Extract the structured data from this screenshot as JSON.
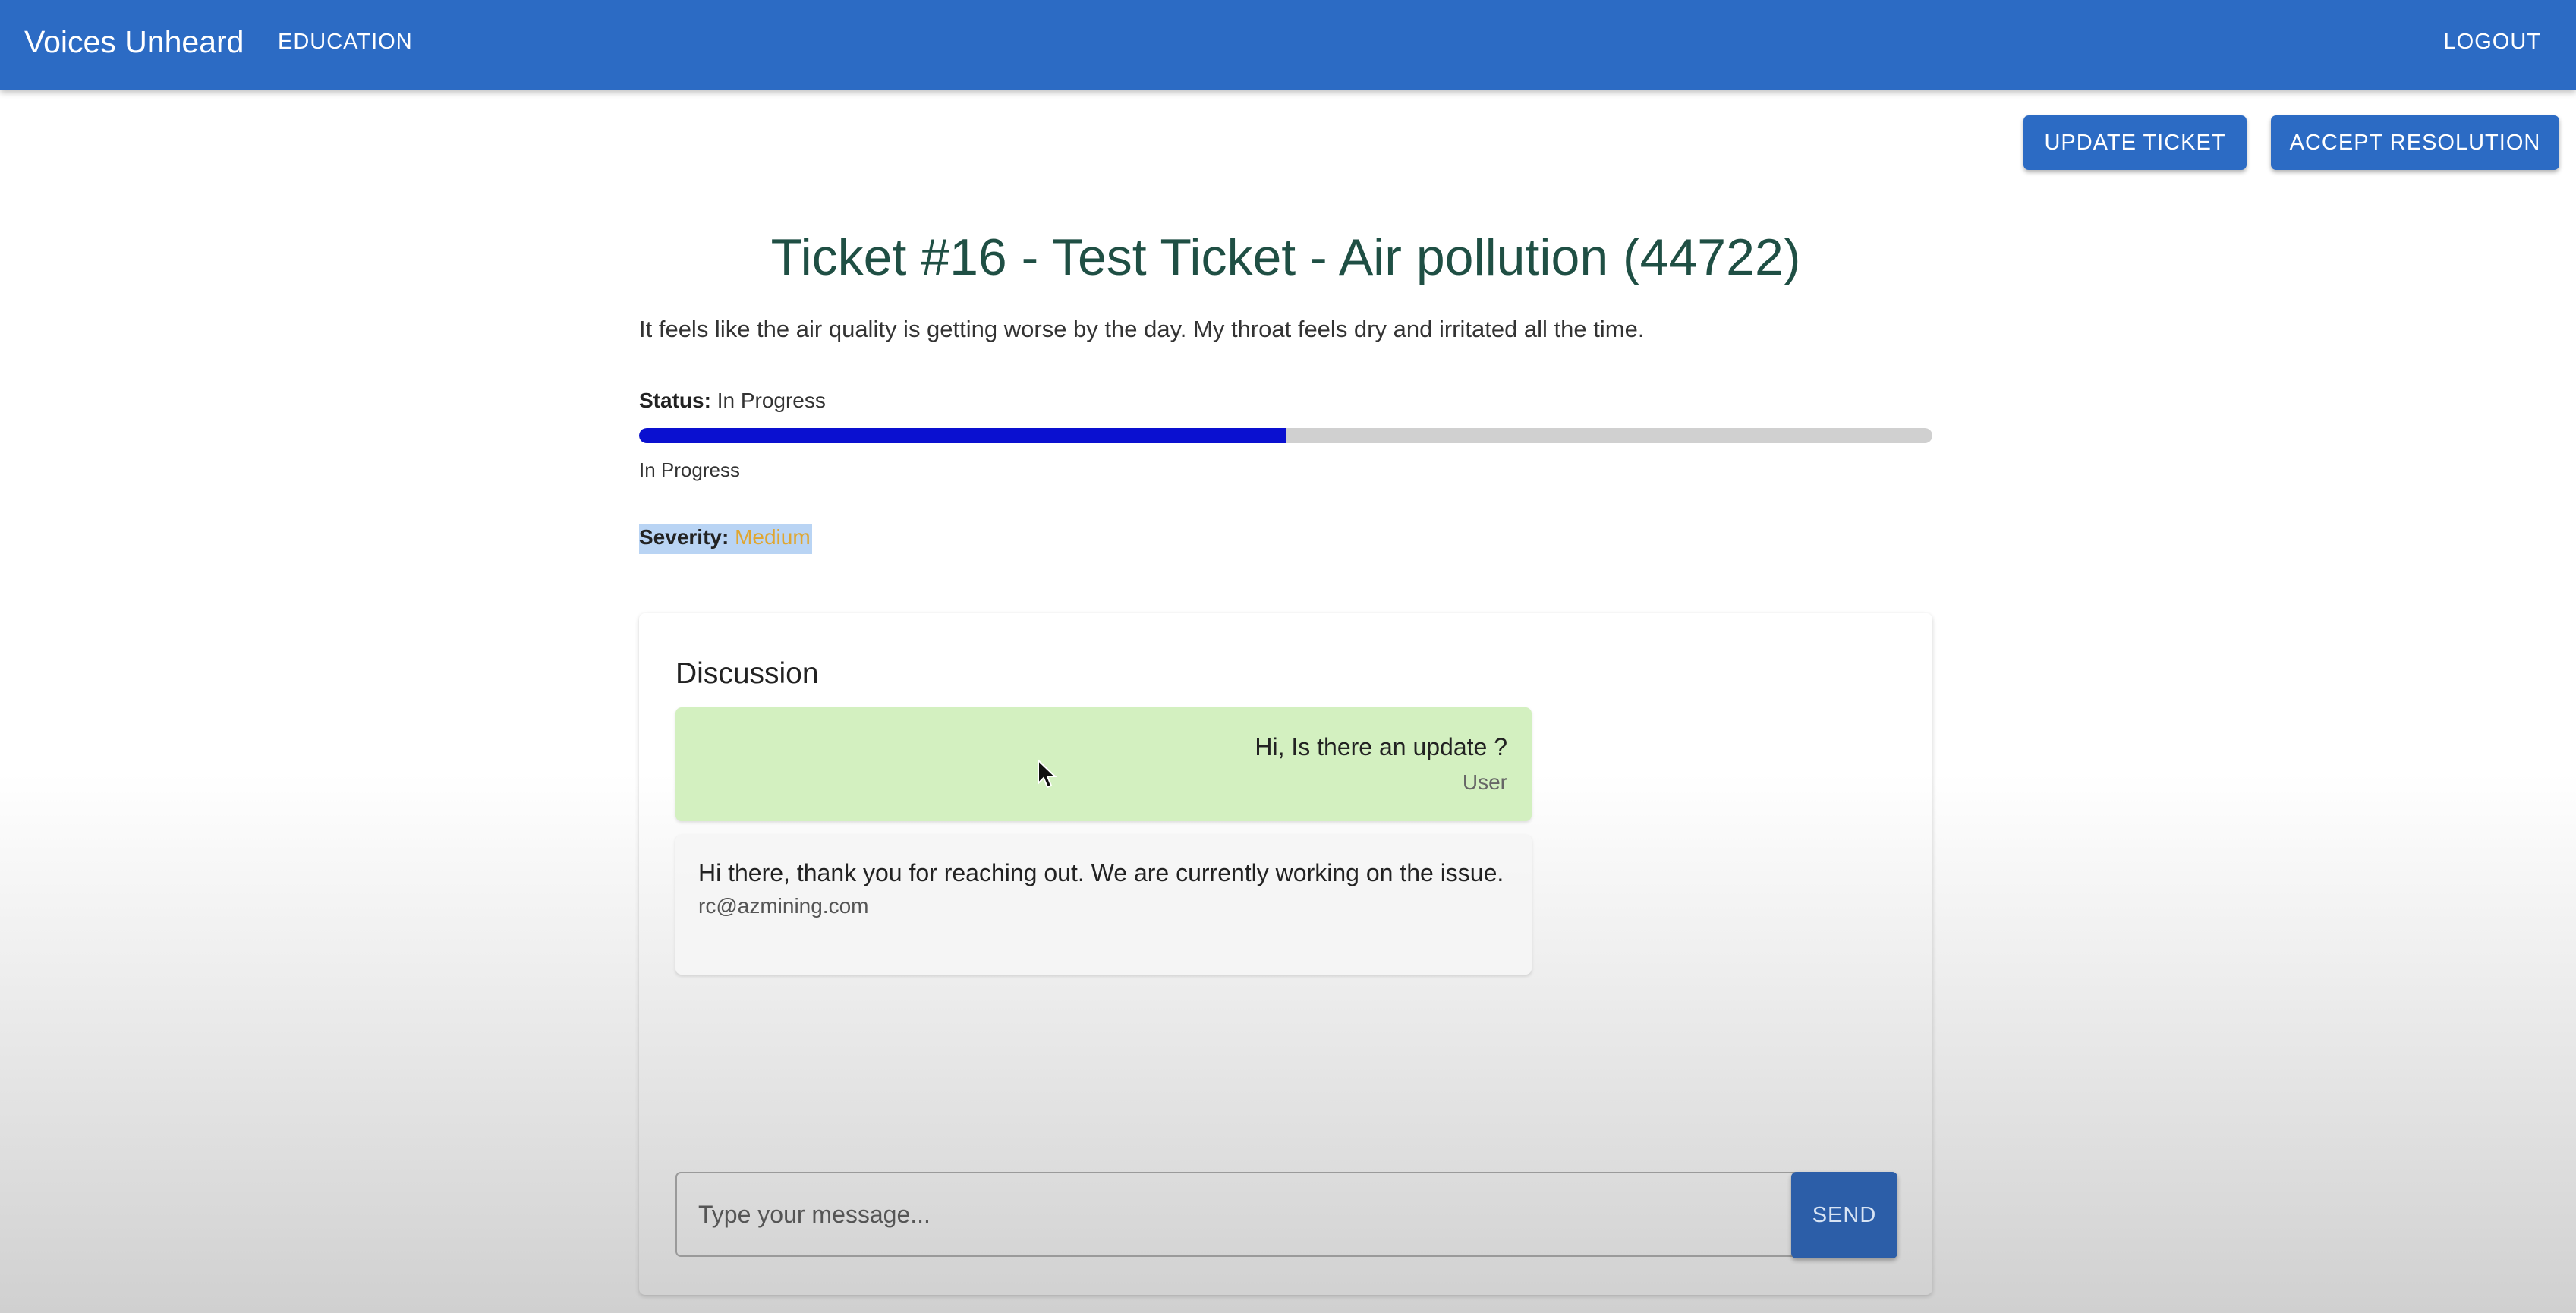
{
  "app": {
    "brand": "Voices Unheard",
    "nav_education": "EDUCATION",
    "nav_logout": "LOGOUT"
  },
  "actions": {
    "update_ticket": "UPDATE TICKET",
    "accept_resolution": "ACCEPT RESOLUTION"
  },
  "ticket": {
    "title": "Ticket #16 - Test Ticket - Air pollution (44722)",
    "description": "It feels like the air quality is getting worse by the day. My throat feels dry and irritated all the time.",
    "status_label": "Status:",
    "status_value": "In Progress",
    "progress_fraction": 0.5,
    "progress_label": "In Progress",
    "severity_label": "Severity:",
    "severity_value": "Medium",
    "colors": {
      "progress_fill": "#0a10d0",
      "severity": "#e0a630",
      "title": "#1f4f44",
      "appbar": "#2c6bc4"
    }
  },
  "discussion": {
    "title": "Discussion",
    "messages": [
      {
        "text": "Hi, Is there an update ?",
        "sender": "User",
        "side": "right",
        "color": "#d3f0c0"
      },
      {
        "text": "Hi there, thank you for reaching out. We are currently working on the issue.",
        "sender": "rc@azmining.com",
        "side": "left",
        "color": "#f5f5f5"
      }
    ],
    "input_placeholder": "Type your message...",
    "send_label": "SEND"
  },
  "icons": {
    "cursor": "mouse-pointer-icon"
  }
}
